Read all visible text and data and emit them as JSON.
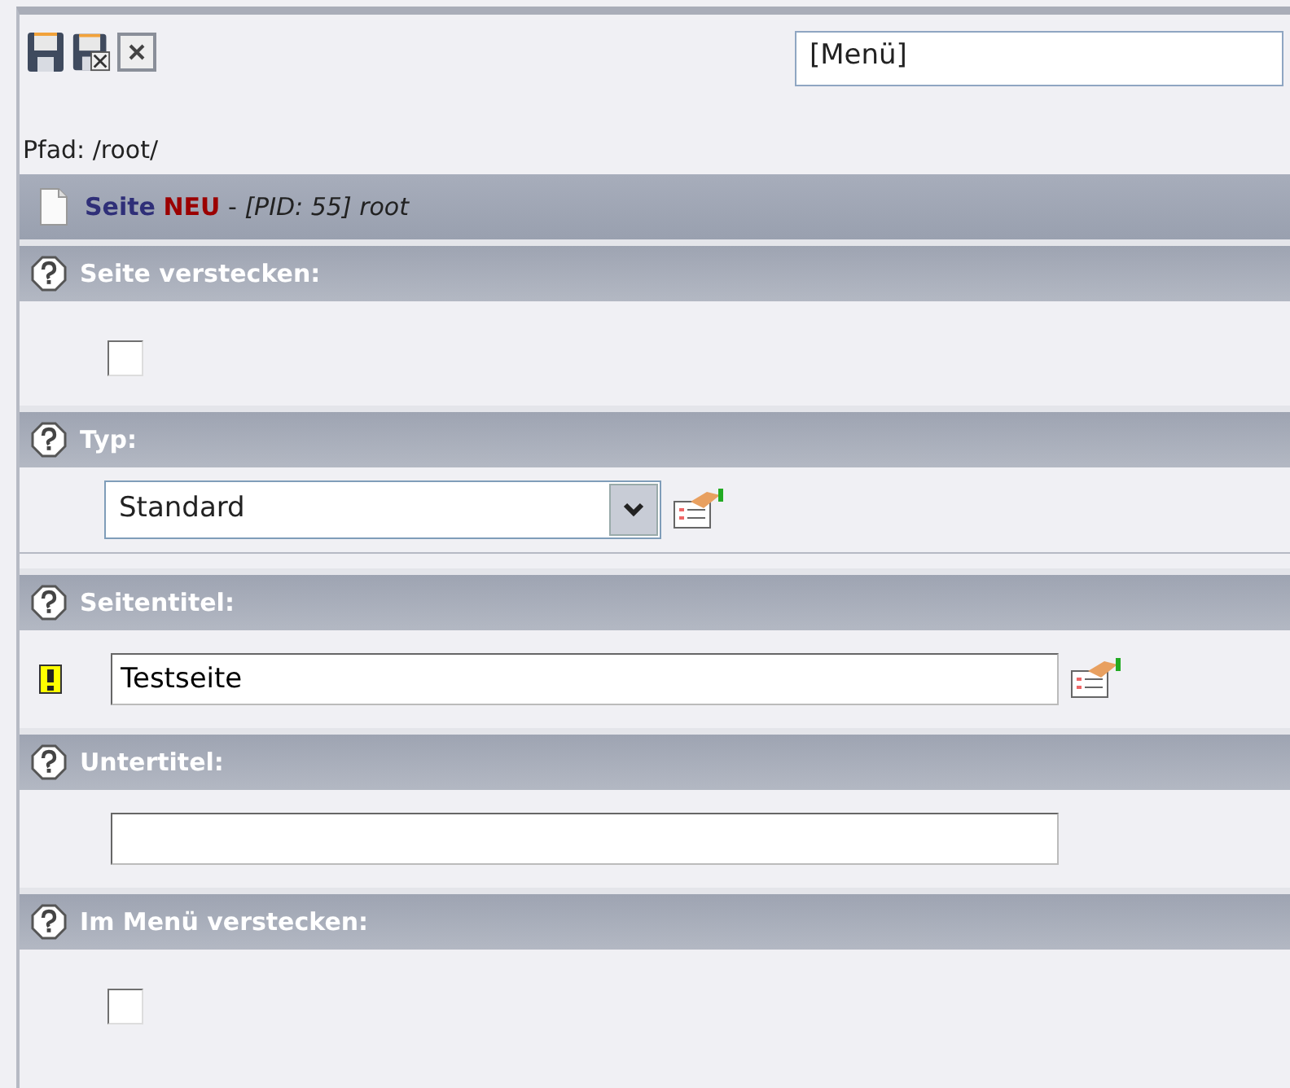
{
  "toolbar": {
    "menu_field": {
      "value": "[Menü]"
    }
  },
  "path": "Pfad: /root/",
  "record_header": {
    "type": "Seite",
    "state": "NEU",
    "separator": "-",
    "pid": "[PID: 55]",
    "name": "root"
  },
  "sections": [
    {
      "label": "Seite verstecken:",
      "kind": "checkbox",
      "checked": false
    },
    {
      "label": "Typ:",
      "kind": "select",
      "value": "Standard",
      "gap_after": true
    },
    {
      "label": "Seitentitel:",
      "kind": "text",
      "value": "Testseite",
      "required": true,
      "wizard": true
    },
    {
      "label": "Untertitel:",
      "kind": "text",
      "required": false,
      "wizard": false
    },
    {
      "label": "Im Menü verstecken:",
      "kind": "checkbox",
      "checked": false
    }
  ]
}
